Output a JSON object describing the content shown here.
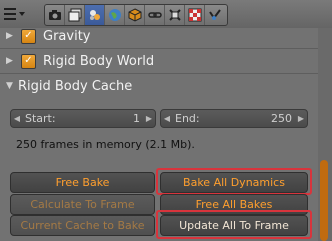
{
  "toolbar": {
    "menu_icon": "panel-menu-icon",
    "tabs": [
      {
        "icon": "camera-icon"
      },
      {
        "icon": "layers-icon"
      },
      {
        "icon": "scene-icon",
        "active": true
      },
      {
        "icon": "world-icon"
      },
      {
        "icon": "cube-icon"
      },
      {
        "icon": "link-icon"
      },
      {
        "icon": "constraint-icon"
      },
      {
        "icon": "texture-icon"
      },
      {
        "icon": "modifier-icon"
      }
    ]
  },
  "panels": {
    "gravity_label": "Gravity",
    "rigid_body_world_label": "Rigid Body World",
    "rigid_body_cache_label": "Rigid Body Cache"
  },
  "cache": {
    "start_label": "Start:",
    "start_value": "1",
    "end_label": "End:",
    "end_value": "250",
    "memory_info": "250 frames in memory (2.1 Mb)."
  },
  "buttons": {
    "free_bake": "Free Bake",
    "bake_all_dynamics": "Bake All Dynamics",
    "calculate_to_frame": "Calculate To Frame",
    "free_all_bakes": "Free All Bakes",
    "current_cache_to_bake": "Current Cache to Bake",
    "update_all_to_frame": "Update All To Frame"
  },
  "colors": {
    "accent_orange": "#ff9f2e",
    "checkbox": "#e0911c",
    "highlight_red": "#d8343c",
    "panel_bg": "#727272"
  }
}
